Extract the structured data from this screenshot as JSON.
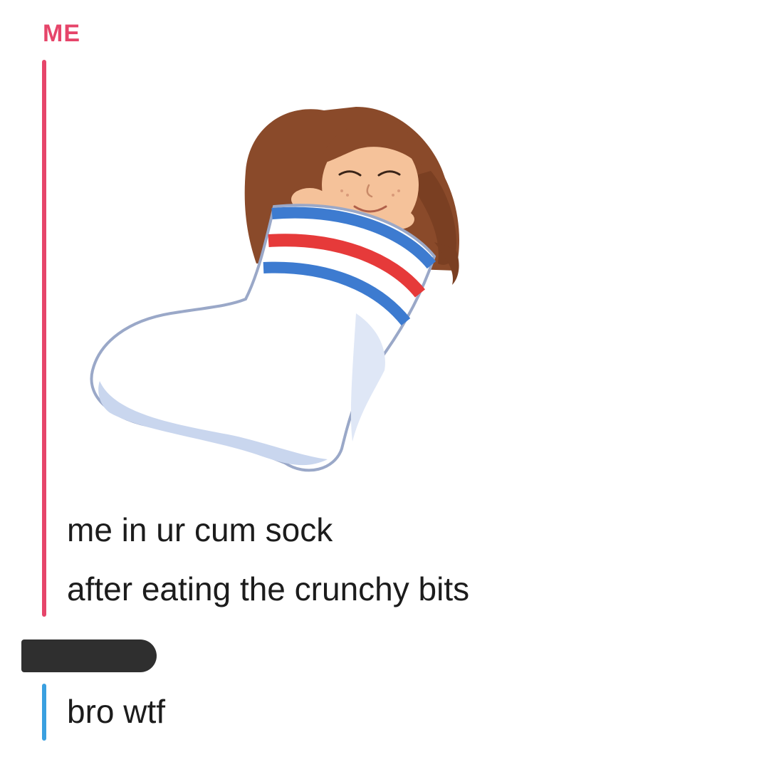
{
  "chat": {
    "sender_me": "ME",
    "message_me_line1": "me in ur cum sock",
    "message_me_line2": "after eating the crunchy bits",
    "message_them": "bro wtf"
  },
  "sticker": {
    "name": "bitmoji-in-sock"
  },
  "colors": {
    "me_accent": "#e6456a",
    "them_accent": "#3aa0e0",
    "redaction": "#2f2f2f"
  }
}
